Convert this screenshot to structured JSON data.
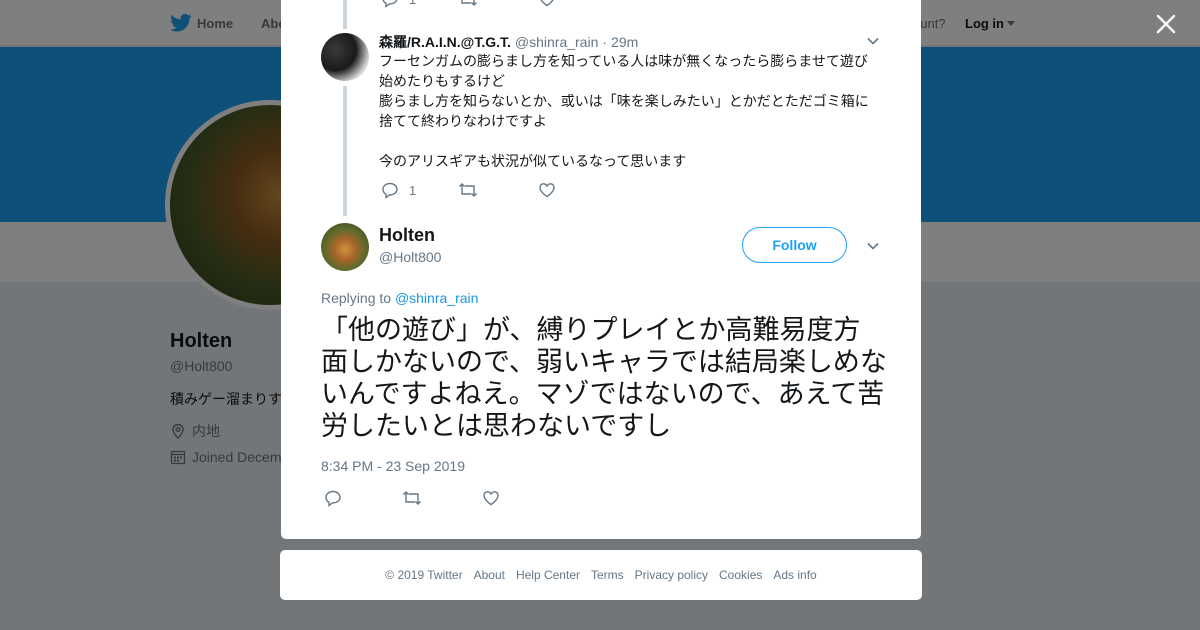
{
  "nav": {
    "home": "Home",
    "about": "Abo",
    "account_prompt": "ccount?",
    "login": "Log in"
  },
  "profile": {
    "name": "Holten",
    "handle": "@Holt800",
    "bio": "積みゲー溜まりす",
    "location": "内地",
    "joined": "Joined Decem"
  },
  "colors": {
    "brand_blue": "#1da1f2",
    "link_blue": "#1b95e0",
    "text_primary": "#14171a",
    "text_secondary": "#657786"
  },
  "reply_tweet": {
    "name": "森羅/R.A.I.N.@T.G.T.",
    "handle": "@shinra_rain",
    "separator": "·",
    "time": "29m",
    "body_lines": [
      "フーセンガムの膨らまし方を知っている人は味が無くなったら膨らませて遊び",
      "始めたりもするけど",
      "膨らまし方を知らないとか、或いは「味を楽しみたい」とかだとただゴミ箱に",
      "捨てて終わりなわけですよ",
      "",
      "今のアリスギアも状況が似ているなって思います"
    ],
    "reply_count": "1",
    "top_reply_count": "1"
  },
  "main_tweet": {
    "name": "Holten",
    "handle": "@Holt800",
    "follow_label": "Follow",
    "replying_prefix": "Replying to",
    "replying_to": "@shinra_rain",
    "text": "「他の遊び」が、縛りプレイとか高難易度方面しかないので、弱いキャラでは結局楽しめないんですよねえ。マゾではないので、あえて苦労したいとは思わないですし",
    "timestamp": "8:34 PM - 23 Sep 2019"
  },
  "footer": {
    "links": [
      "© 2019 Twitter",
      "About",
      "Help Center",
      "Terms",
      "Privacy policy",
      "Cookies",
      "Ads info"
    ]
  },
  "icons": [
    "twitter-bird-icon",
    "close-icon",
    "location-pin-icon",
    "calendar-icon",
    "reply-icon",
    "retweet-icon",
    "like-icon",
    "chevron-down-icon"
  ]
}
